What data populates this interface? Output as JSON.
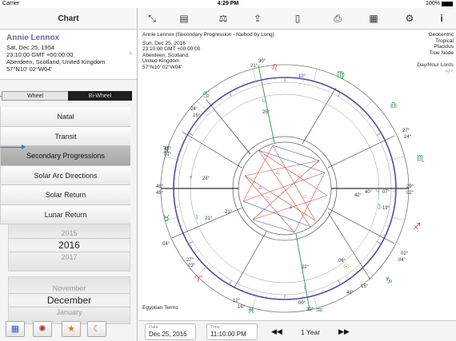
{
  "status_bar": {
    "carrier": "Carrier",
    "time": "4:29 PM",
    "battery": "100%"
  },
  "sidebar": {
    "title": "Chart",
    "person": {
      "name": "Annie Lennox",
      "date": "Sat, Dec 25, 1954",
      "time": "23:10:00 GMT +00:00:00",
      "place": "Aberdeen, Scotland, United Kingdom",
      "coords": "57°N10' 02°W04'"
    },
    "wheel_toggle": {
      "wheel": "Wheel",
      "biwheel": "Bi-Wheel",
      "selected": "Wheel"
    },
    "menu": [
      {
        "label": "Natal"
      },
      {
        "label": "Transit"
      },
      {
        "label": "Secondary Progressions",
        "selected": true
      },
      {
        "label": "Solar Arc Directions"
      },
      {
        "label": "Solar Return"
      },
      {
        "label": "Lunar Return"
      }
    ],
    "year_picker": {
      "prev": "2015",
      "selected": "2016",
      "next": "2017"
    },
    "month_picker": {
      "prev": "November",
      "selected": "December",
      "next": "January"
    },
    "bottom_icons": [
      "grid-icon",
      "aspect-icon",
      "stars-icon",
      "moon-icon"
    ]
  },
  "toolbar": {
    "icons": [
      "expand-icon",
      "id-card-icon",
      "balance-icon",
      "share-icon",
      "document-icon",
      "printer-icon",
      "table-icon",
      "settings-icon",
      "info-icon"
    ]
  },
  "chart_info": {
    "title": "Annie Lennox (Secondary Progression - Naibod by Long)",
    "date": "Sun, Dec 25, 2016",
    "time": "23:10:00 GMT +00:00:00",
    "city": "Aberdeen, Scotland,",
    "country": "United Kingdom",
    "coords": "57°N10' 02°W04'",
    "settings": [
      "Geocentric",
      "Tropical",
      "Placidus",
      "True Node"
    ],
    "lords_label": "Day/Hour Lords",
    "lords_values": "♃/♀",
    "terms": "Egyptian Terms"
  },
  "wheel": {
    "outer_degrees": [
      "21°",
      "30°",
      "12°",
      "24°",
      "16°",
      "48°",
      "01°",
      "27°",
      "24°",
      "48°",
      "45°",
      "29°",
      "02°",
      "04°",
      "27°",
      "03°",
      "02°",
      "04°",
      "12°",
      "16°",
      "00°",
      "32°",
      "42°",
      "21°",
      "15°",
      "48°"
    ],
    "planets": [
      {
        "label": "♄",
        "deg": "25°"
      },
      {
        "label": "♆",
        "deg": "28°"
      },
      {
        "label": "☿",
        "deg": "21°"
      },
      {
        "label": "♀",
        "deg": "22°"
      },
      {
        "label": "♃",
        "deg": "40°"
      },
      {
        "label": "♂",
        "deg": "07°"
      },
      {
        "label": "☽",
        "deg": "19°"
      },
      {
        "label": "☉",
        "deg": "06°"
      }
    ]
  },
  "bottom_bar": {
    "date_label": "Date",
    "date_value": "Dec 25, 2016",
    "time_label": "Time",
    "time_value": "11:10:00 PM",
    "step_label": "1 Year",
    "prev_symbol": "◀◀",
    "next_symbol": "▶▶"
  }
}
